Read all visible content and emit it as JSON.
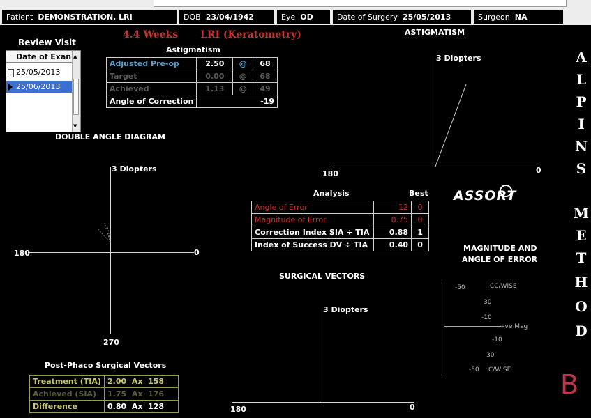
{
  "header": {
    "patient_label": "Patient",
    "patient_name": "DEMONSTRATION, LRI",
    "dob_label": "DOB",
    "dob_value": "23/04/1942",
    "eye_label": "Eye",
    "eye_value": "OD",
    "surgery_label": "Date of Surgery",
    "surgery_value": "25/05/2013",
    "surgeon_label": "Surgeon",
    "surgeon_value": "NA"
  },
  "visit_title": "4.4 Weeks",
  "procedure_title": "LRI (Keratometry)",
  "review": {
    "title": "Review Visit",
    "column_header": "Date of Exan",
    "dates": [
      "25/05/2013",
      "25/06/2013"
    ],
    "selected_index": 1
  },
  "astig_table": {
    "title": "Astigmatism",
    "rows": [
      {
        "label": "Adjusted Pre-op",
        "value": "2.50",
        "at": "@",
        "axis": "68"
      },
      {
        "label": "Target",
        "value": "0.00",
        "at": "@",
        "axis": "68"
      },
      {
        "label": "Achieved",
        "value": "1.13",
        "at": "@",
        "axis": "49"
      }
    ],
    "correction_label": "Angle of Correction",
    "correction_value": "-19"
  },
  "double_angle": {
    "title": "DOUBLE ANGLE DIAGRAM",
    "scale": "3 Diopters",
    "left": "180",
    "right": "0",
    "bottom": "270"
  },
  "astigmatism_plot": {
    "title": "ASTIGMATISM",
    "scale": "3 Diopters",
    "left": "180",
    "right": "0"
  },
  "analysis": {
    "title": "Analysis",
    "best_title": "Best",
    "rows": [
      {
        "label": "Angle of Error",
        "value": "12",
        "best": "0"
      },
      {
        "label": "Magnitude of Error",
        "value": "0.75",
        "best": "0"
      },
      {
        "label": "Correction Index  SIA ÷ TIA",
        "value": "0.88",
        "best": "1"
      },
      {
        "label": "Index of Success  DV ÷ TIA",
        "value": "0.40",
        "best": "0"
      }
    ]
  },
  "logo_text": "ASSORT",
  "mag_error": {
    "title_line1": "MAGNITUDE AND",
    "title_line2": "ANGLE OF ERROR",
    "ticks": [
      "-50",
      "CC/WISE",
      "30",
      "-10",
      "+ve Mag",
      "-10",
      "30",
      "-50",
      "C/WISE"
    ]
  },
  "surgical_vectors": {
    "title": "SURGICAL VECTORS",
    "scale": "3 Diopters",
    "left": "180",
    "right": "0"
  },
  "post_phaco": {
    "title": "Post-Phaco Surgical Vectors",
    "rows": [
      {
        "label": "Treatment (TIA)",
        "value": "2.00",
        "ax": "Ax",
        "axis": "158"
      },
      {
        "label": "Achieved (SIA)",
        "value": "1.75",
        "ax": "Ax",
        "axis": "176"
      },
      {
        "label": "Difference",
        "value": "0.80",
        "ax": "Ax",
        "axis": "128"
      }
    ]
  },
  "side_title": [
    "A",
    "L",
    "P",
    "I",
    "N",
    "S",
    "",
    "M",
    "E",
    "T",
    "H",
    "O",
    "D"
  ],
  "panel_letter": "B",
  "colors": {
    "label_red": "#c8302c",
    "highlight_blue": "#3b6fd1",
    "olive": "#c8c86a",
    "letter_b": "#c0364a"
  }
}
